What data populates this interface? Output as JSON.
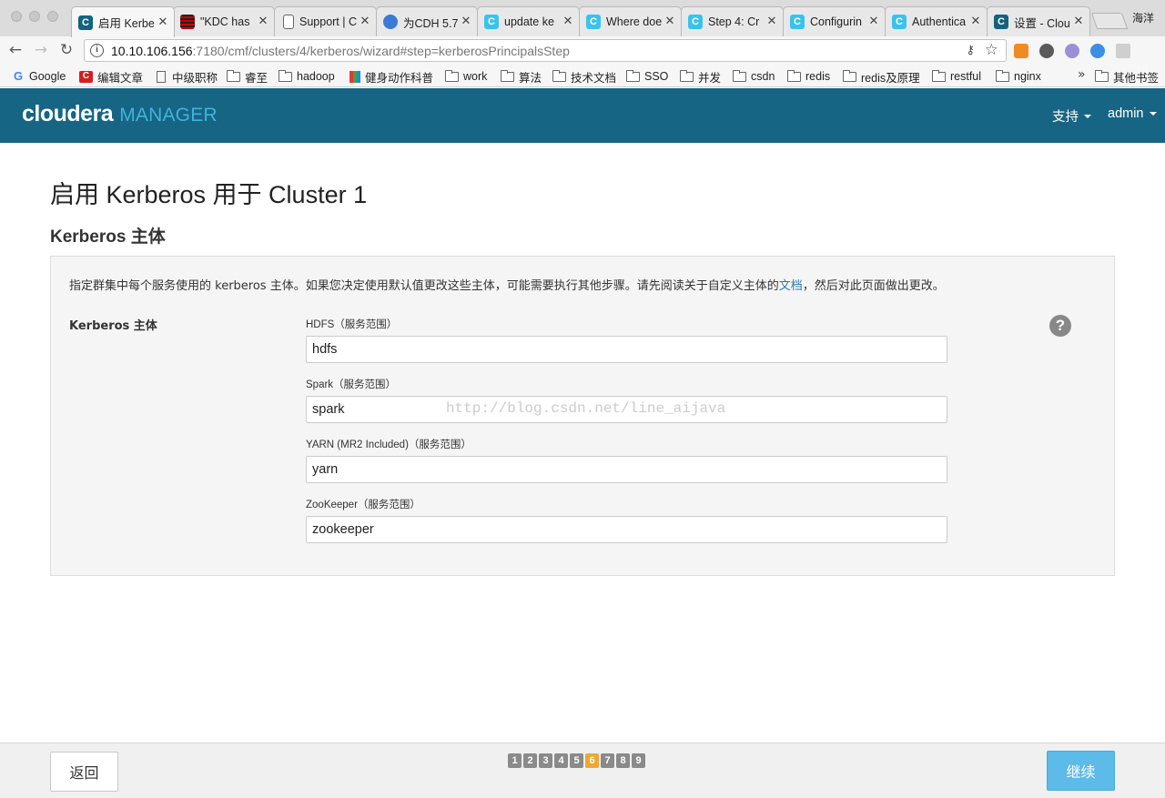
{
  "browser": {
    "tabs": [
      {
        "title": "启用 Kerberos",
        "favicon": "cloudera-dark-icon",
        "active": true
      },
      {
        "title": "\"KDC has",
        "favicon": "stripe-icon"
      },
      {
        "title": "Support | C",
        "favicon": "document-icon"
      },
      {
        "title": "为CDH 5.7",
        "favicon": "globe-icon"
      },
      {
        "title": "update ke",
        "favicon": "cloudera-light-icon"
      },
      {
        "title": "Where doe",
        "favicon": "cloudera-light-icon"
      },
      {
        "title": "Step 4: Cr",
        "favicon": "cloudera-light-icon"
      },
      {
        "title": "Configurin",
        "favicon": "cloudera-light-icon"
      },
      {
        "title": "Authentica",
        "favicon": "cloudera-light-icon"
      },
      {
        "title": "设置 - Clou",
        "favicon": "cloudera-dark-icon"
      }
    ],
    "profile_name": "海洋",
    "url_host": "10.10.106.156",
    "url_rest": ":7180/cmf/clusters/4/kerberos/wizard#step=kerberosPrincipalsStep",
    "bookmarks": [
      "Google",
      "编辑文章",
      "中级职称",
      "睿至",
      "hadoop",
      "健身动作科普",
      "work",
      "算法",
      "技术文档",
      "SSO",
      "并发",
      "csdn",
      "redis",
      "redis及原理",
      "restful",
      "nginx"
    ],
    "bookmarks_more": "»",
    "other_bookmarks": "其他书签"
  },
  "header": {
    "brand": "cloudera",
    "product": "MANAGER",
    "support_menu": "支持",
    "user_menu": "admin",
    "colors": {
      "bar": "#176584",
      "product": "#3fb3dc"
    }
  },
  "page": {
    "title": "启用 Kerberos 用于 Cluster 1",
    "section_title": "Kerberos 主体",
    "intro_before": "指定群集中每个服务使用的 kerberos 主体。如果您决定使用默认值更改这些主体，可能需要执行其他步骤。请先阅读关于自定义主体的",
    "intro_link": "文档",
    "intro_after": "，然后对此页面做出更改。",
    "row_label": "Kerberos 主体",
    "fields": [
      {
        "label": "HDFS（服务范围）",
        "value": "hdfs"
      },
      {
        "label": "Spark（服务范围）",
        "value": "spark"
      },
      {
        "label": "YARN (MR2 Included)（服务范围）",
        "value": "yarn"
      },
      {
        "label": "ZooKeeper（服务范围）",
        "value": "zookeeper"
      }
    ],
    "help": "?",
    "watermark": "http://blog.csdn.net/line_aijava"
  },
  "footer": {
    "back_label": "返回",
    "next_label": "继续",
    "steps": [
      "1",
      "2",
      "3",
      "4",
      "5",
      "6",
      "7",
      "8",
      "9"
    ],
    "current_step": "6",
    "colors": {
      "next": "#5cbbe8",
      "current_step": "#f0a830",
      "step": "#8a8a8a"
    }
  }
}
